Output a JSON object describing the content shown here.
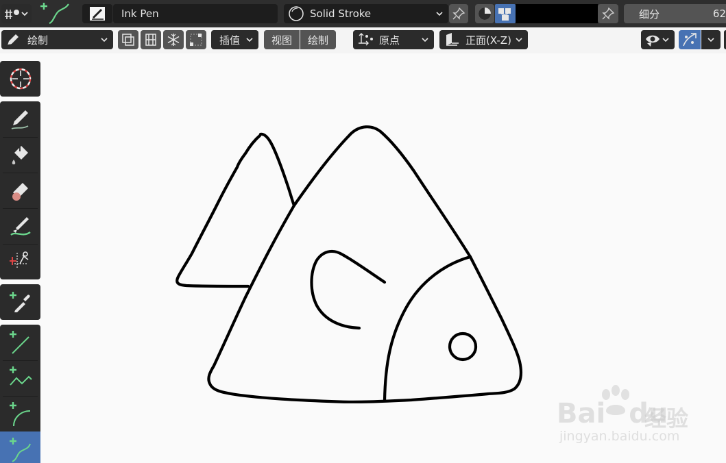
{
  "topbar": {
    "brush_name": "Ink Pen",
    "material_name": "Solid Stroke",
    "subdivision_label": "细分",
    "subdivision_value": "62",
    "stroke_color": "#000000"
  },
  "header": {
    "mode_label": "绘制",
    "interpolate_label": "插值",
    "view_label": "视图",
    "draw_label": "绘制",
    "origin_label": "原点",
    "plane_label": "正面(X-Z)"
  },
  "tools": [
    {
      "name": "cursor",
      "icon": "cursor-icon"
    },
    {
      "name": "draw",
      "icon": "pencil-icon"
    },
    {
      "name": "fill",
      "icon": "fill-bucket-icon"
    },
    {
      "name": "erase",
      "icon": "eraser-icon"
    },
    {
      "name": "tint",
      "icon": "tint-brush-icon"
    },
    {
      "name": "cutter",
      "icon": "cutter-icon"
    },
    {
      "name": "eyedropper",
      "icon": "eyedropper-icon"
    },
    {
      "name": "line",
      "icon": "line-icon"
    },
    {
      "name": "polyline",
      "icon": "polyline-icon"
    },
    {
      "name": "arc",
      "icon": "arc-icon"
    },
    {
      "name": "curve",
      "icon": "curve-icon",
      "active": true
    }
  ],
  "watermark": {
    "brand": "Bai",
    "brand2": "du",
    "cn": "经验",
    "url": "jingyan.baidu.com"
  },
  "colors": {
    "accent": "#4772b3",
    "panel": "#2b2b2b",
    "field": "#1d1d1d",
    "button": "#545454",
    "canvas": "#fafafa",
    "tool_green": "#6bd68c"
  }
}
